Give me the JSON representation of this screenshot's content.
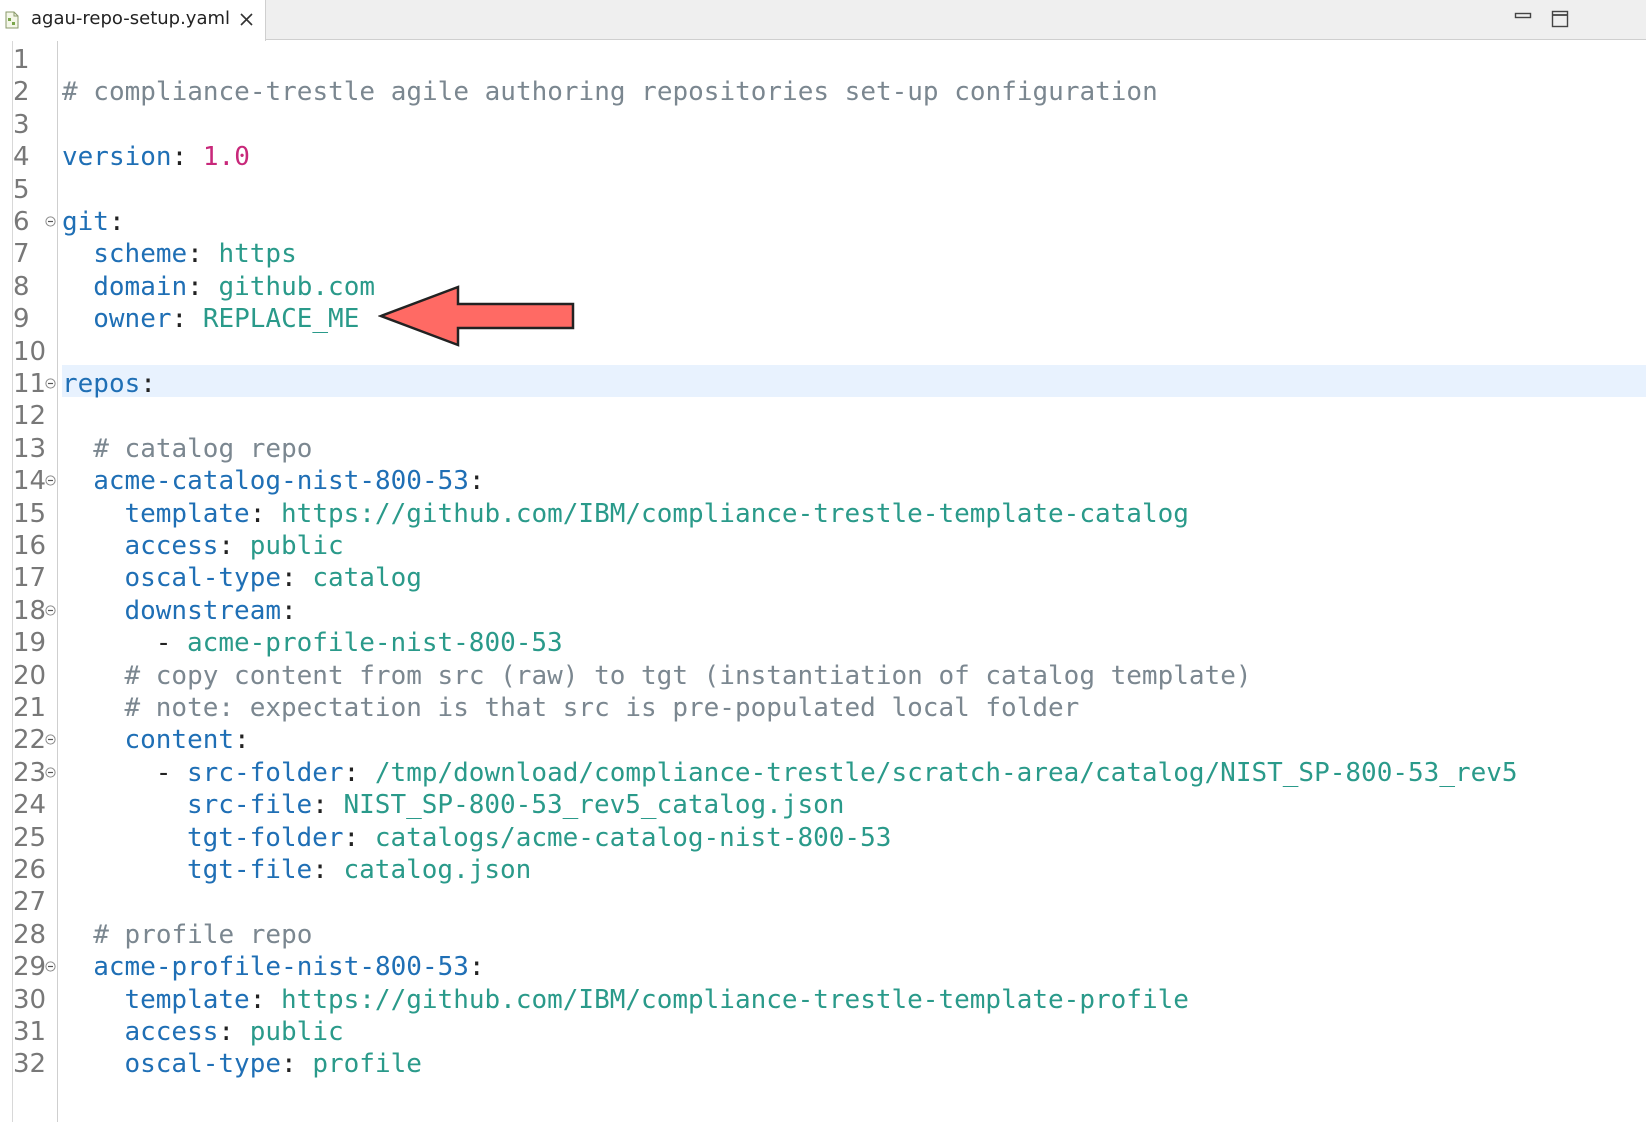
{
  "tab": {
    "filename": "agau-repo-setup.yaml",
    "icons": {
      "file": "yaml-file-icon",
      "close": "close-icon"
    }
  },
  "window": {
    "icons": [
      "minimize-icon",
      "maximize-icon"
    ]
  },
  "annotation": {
    "arrow_color": "#ff6a64",
    "target_line": 9
  },
  "editor": {
    "highlighted_line": 11,
    "colors": {
      "key": "#1f6fb5",
      "value": "#2a9a8a",
      "number": "#c8287a",
      "comment": "#7b8790"
    },
    "lines": [
      {
        "num": "1",
        "indent": 0,
        "fold": false,
        "comment": ""
      },
      {
        "num": "2",
        "indent": 0,
        "fold": false,
        "comment": "# compliance-trestle agile authoring repositories set-up configuration"
      },
      {
        "num": "3",
        "indent": 0,
        "fold": false
      },
      {
        "num": "4",
        "indent": 0,
        "fold": false,
        "key": "version",
        "sep": ": ",
        "number": "1.0"
      },
      {
        "num": "5",
        "indent": 0,
        "fold": false
      },
      {
        "num": "6",
        "indent": 0,
        "fold": true,
        "key": "git",
        "sep": ":"
      },
      {
        "num": "7",
        "indent": 2,
        "fold": false,
        "key": "scheme",
        "sep": ": ",
        "value": "https"
      },
      {
        "num": "8",
        "indent": 2,
        "fold": false,
        "key": "domain",
        "sep": ": ",
        "value": "github.com"
      },
      {
        "num": "9",
        "indent": 2,
        "fold": false,
        "key": "owner",
        "sep": ": ",
        "value": "REPLACE_ME"
      },
      {
        "num": "10",
        "indent": 0,
        "fold": false
      },
      {
        "num": "11",
        "indent": 0,
        "fold": true,
        "key": "repos",
        "sep": ":"
      },
      {
        "num": "12",
        "indent": 0,
        "fold": false
      },
      {
        "num": "13",
        "indent": 2,
        "fold": false,
        "comment": "# catalog repo"
      },
      {
        "num": "14",
        "indent": 2,
        "fold": true,
        "key": "acme-catalog-nist-800-53",
        "sep": ":"
      },
      {
        "num": "15",
        "indent": 4,
        "fold": false,
        "key": "template",
        "sep": ": ",
        "value": "https://github.com/IBM/compliance-trestle-template-catalog"
      },
      {
        "num": "16",
        "indent": 4,
        "fold": false,
        "key": "access",
        "sep": ": ",
        "value": "public"
      },
      {
        "num": "17",
        "indent": 4,
        "fold": false,
        "key": "oscal-type",
        "sep": ": ",
        "value": "catalog"
      },
      {
        "num": "18",
        "indent": 4,
        "fold": true,
        "key": "downstream",
        "sep": ":"
      },
      {
        "num": "19",
        "indent": 6,
        "fold": false,
        "dash": "- ",
        "value": "acme-profile-nist-800-53"
      },
      {
        "num": "20",
        "indent": 4,
        "fold": false,
        "comment": "# copy content from src (raw) to tgt (instantiation of catalog template)"
      },
      {
        "num": "21",
        "indent": 4,
        "fold": false,
        "comment": "# note: expectation is that src is pre-populated local folder"
      },
      {
        "num": "22",
        "indent": 4,
        "fold": true,
        "key": "content",
        "sep": ":"
      },
      {
        "num": "23",
        "indent": 6,
        "fold": true,
        "dash": "- ",
        "key": "src-folder",
        "sep": ": ",
        "value": "/tmp/download/compliance-trestle/scratch-area/catalog/NIST_SP-800-53_rev5"
      },
      {
        "num": "24",
        "indent": 8,
        "fold": false,
        "key": "src-file",
        "sep": ": ",
        "value": "NIST_SP-800-53_rev5_catalog.json"
      },
      {
        "num": "25",
        "indent": 8,
        "fold": false,
        "key": "tgt-folder",
        "sep": ": ",
        "value": "catalogs/acme-catalog-nist-800-53"
      },
      {
        "num": "26",
        "indent": 8,
        "fold": false,
        "key": "tgt-file",
        "sep": ": ",
        "value": "catalog.json"
      },
      {
        "num": "27",
        "indent": 0,
        "fold": false
      },
      {
        "num": "28",
        "indent": 2,
        "fold": false,
        "comment": "# profile repo"
      },
      {
        "num": "29",
        "indent": 2,
        "fold": true,
        "key": "acme-profile-nist-800-53",
        "sep": ":"
      },
      {
        "num": "30",
        "indent": 4,
        "fold": false,
        "key": "template",
        "sep": ": ",
        "value": "https://github.com/IBM/compliance-trestle-template-profile"
      },
      {
        "num": "31",
        "indent": 4,
        "fold": false,
        "key": "access",
        "sep": ": ",
        "value": "public"
      },
      {
        "num": "32",
        "indent": 4,
        "fold": false,
        "key": "oscal-type",
        "sep": ": ",
        "value": "profile"
      }
    ]
  }
}
